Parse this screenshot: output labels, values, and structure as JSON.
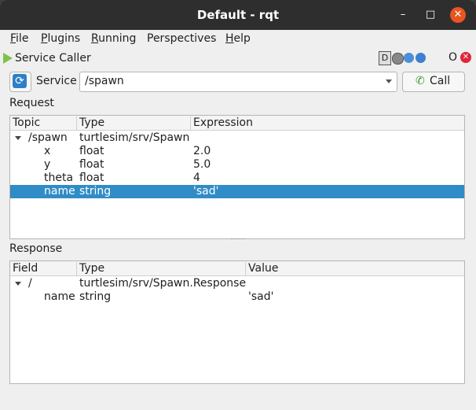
{
  "window": {
    "title": "Default - rqt",
    "close_glyph": "✕",
    "max_glyph": "□",
    "min_glyph": "–"
  },
  "menu": {
    "items": [
      {
        "acc": "F",
        "rest": "ile"
      },
      {
        "acc": "P",
        "rest": "lugins"
      },
      {
        "acc": "R",
        "rest": "unning"
      },
      {
        "acc": "",
        "rest": "Perspectives",
        "acc_mid": "P"
      },
      {
        "acc": "H",
        "rest": "elp"
      }
    ]
  },
  "dock": {
    "title": "Service Caller",
    "d_label": "D",
    "o_label": "O",
    "close_glyph": "✕"
  },
  "service": {
    "label": "Service",
    "value": "/spawn",
    "call_label": "Call",
    "refresh_glyph": "⟳",
    "call_glyph": "✆"
  },
  "request": {
    "label": "Request",
    "columns": [
      "Topic",
      "Type",
      "Expression"
    ],
    "rows": [
      {
        "topic": "/spawn",
        "type": "turtlesim/srv/Spawn",
        "expr": ""
      },
      {
        "topic": "x",
        "type": "float",
        "expr": "2.0"
      },
      {
        "topic": "y",
        "type": "float",
        "expr": "5.0"
      },
      {
        "topic": "theta",
        "type": "float",
        "expr": "4"
      },
      {
        "topic": "name",
        "type": "string",
        "expr": "'sad'"
      }
    ]
  },
  "response": {
    "label": "Response",
    "columns": [
      "Field",
      "Type",
      "Value"
    ],
    "rows": [
      {
        "field": "/",
        "type": "turtlesim/srv/Spawn.Response",
        "value": ""
      },
      {
        "field": "name",
        "type": "string",
        "value": "'sad'"
      }
    ]
  },
  "colors": {
    "selection": "#308cc6",
    "titlebar": "#2e2e2e",
    "close_button": "#e95420"
  }
}
